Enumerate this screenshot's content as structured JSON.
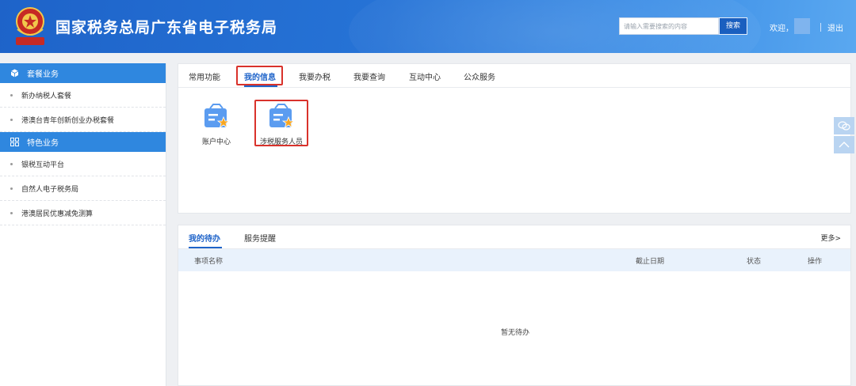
{
  "header": {
    "site_title": "国家税务总局广东省电子税务局",
    "search_placeholder": "请输入需要搜索的内容",
    "search_button": "搜索",
    "welcome": "欢迎，",
    "separator": "|",
    "logout": "退出"
  },
  "sidebar": {
    "categories": [
      {
        "label": "套餐业务",
        "icon": "package-icon",
        "items": [
          "新办纳税人套餐",
          "港澳台青年创新创业办税套餐"
        ]
      },
      {
        "label": "特色业务",
        "icon": "grid-icon",
        "items": [
          "银税互动平台",
          "自然人电子税务局",
          "港澳居民优惠减免测算"
        ]
      }
    ]
  },
  "main": {
    "tabs": [
      "常用功能",
      "我的信息",
      "我要办税",
      "我要查询",
      "互动中心",
      "公众服务"
    ],
    "active_tab": "我的信息",
    "apps": [
      {
        "label": "账户中心",
        "icon": "account-card-icon"
      },
      {
        "label": "涉税服务人员",
        "icon": "account-card-icon"
      }
    ]
  },
  "todo": {
    "tabs": [
      "我的待办",
      "服务提醒"
    ],
    "more": "更多>",
    "columns": [
      "事项名称",
      "截止日期",
      "状态",
      "操作"
    ],
    "empty_text": "暂无待办"
  },
  "colors": {
    "header_blue": "#2673d6",
    "sidebar_category": "#2f87df",
    "active_blue": "#1e63c9",
    "highlight_red": "#d9322b"
  }
}
